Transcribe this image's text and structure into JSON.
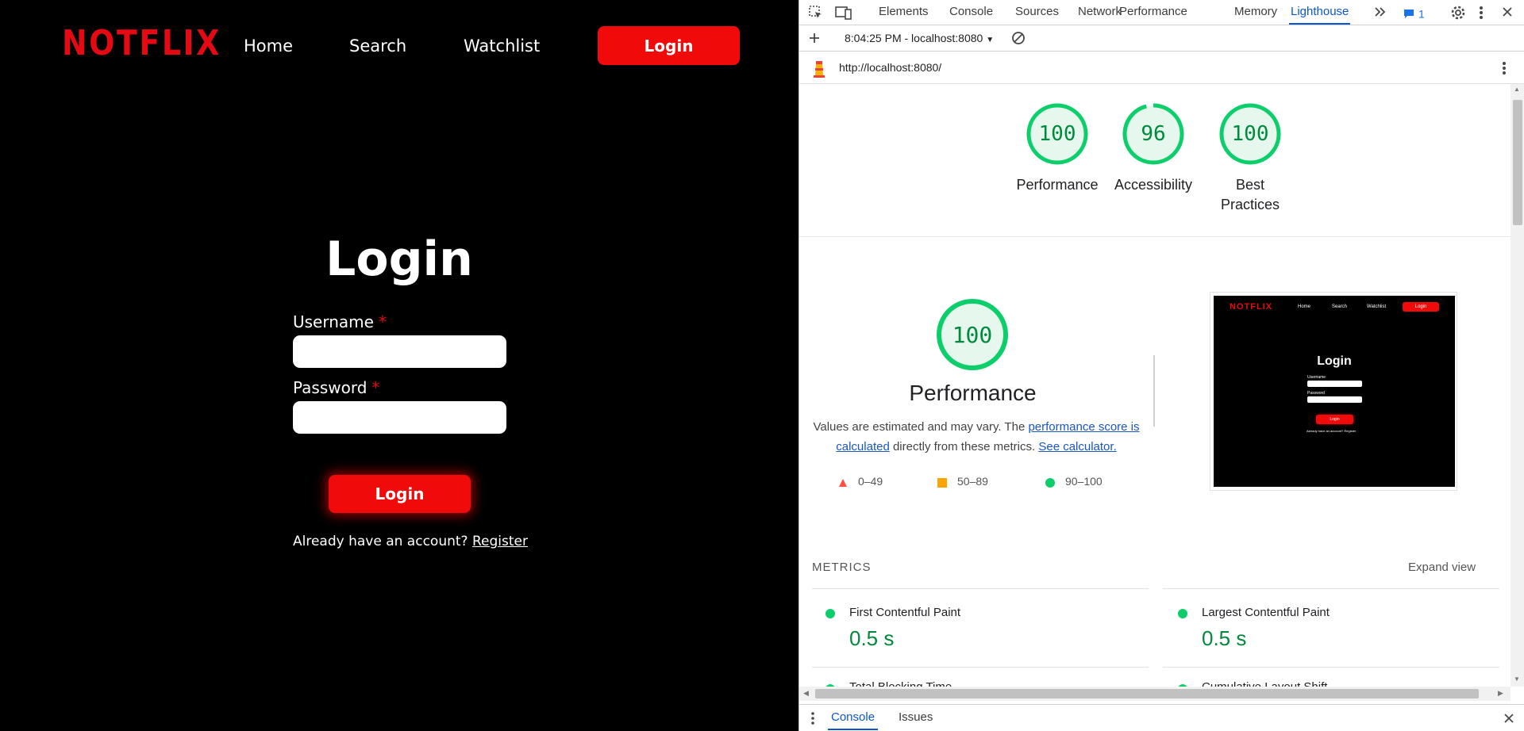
{
  "app": {
    "logo": "NOTFLIX",
    "nav": {
      "home": "Home",
      "search": "Search",
      "watchlist": "Watchlist",
      "login": "Login"
    },
    "form": {
      "title": "Login",
      "username_label": "Username",
      "password_label": "Password",
      "required_mark": "*",
      "submit": "Login",
      "already_text": "Already have an account?",
      "register_link": "Register"
    }
  },
  "devtools": {
    "tabs": [
      "Elements",
      "Console",
      "Sources",
      "Network",
      "Performance",
      "Memory",
      "Lighthouse"
    ],
    "active_tab": "Lighthouse",
    "issues_count": "1",
    "report_selector": "8:04:25 PM - localhost:8080",
    "url": "http://localhost:8080/",
    "scores": [
      {
        "label": "Performance",
        "value": "100"
      },
      {
        "label": "Accessibility",
        "value": "96"
      },
      {
        "label": "Best Practices",
        "value": "100"
      }
    ],
    "perf": {
      "score": "100",
      "title": "Performance",
      "desc_prefix": "Values are estimated and may vary. The ",
      "desc_link1": "performance score is calculated",
      "desc_middle": " directly from these metrics. ",
      "desc_link2": "See calculator."
    },
    "legend": [
      {
        "range": "0–49",
        "color": "#ff4e42"
      },
      {
        "range": "50–89",
        "color": "#ffa400"
      },
      {
        "range": "90–100",
        "color": "#0cce6b"
      }
    ],
    "thumbnail": {
      "logo": "NOTFLIX",
      "nav": [
        "Home",
        "Search",
        "Watchlist",
        "Login"
      ],
      "title": "Login",
      "username": "Username",
      "password": "Password",
      "button": "Login",
      "footer": "Already have an account? Register"
    },
    "metrics": {
      "heading": "METRICS",
      "expand": "Expand view",
      "items": [
        {
          "name": "First Contentful Paint",
          "value": "0.5 s"
        },
        {
          "name": "Largest Contentful Paint",
          "value": "0.5 s"
        },
        {
          "name": "Total Blocking Time",
          "value": ""
        },
        {
          "name": "Cumulative Layout Shift",
          "value": ""
        }
      ]
    },
    "drawer": {
      "console": "Console",
      "issues": "Issues"
    },
    "colors": {
      "pass": "#0cce6b",
      "pass_text": "#008a3b",
      "accent": "#0b57d0",
      "brand": "#e50914"
    }
  }
}
